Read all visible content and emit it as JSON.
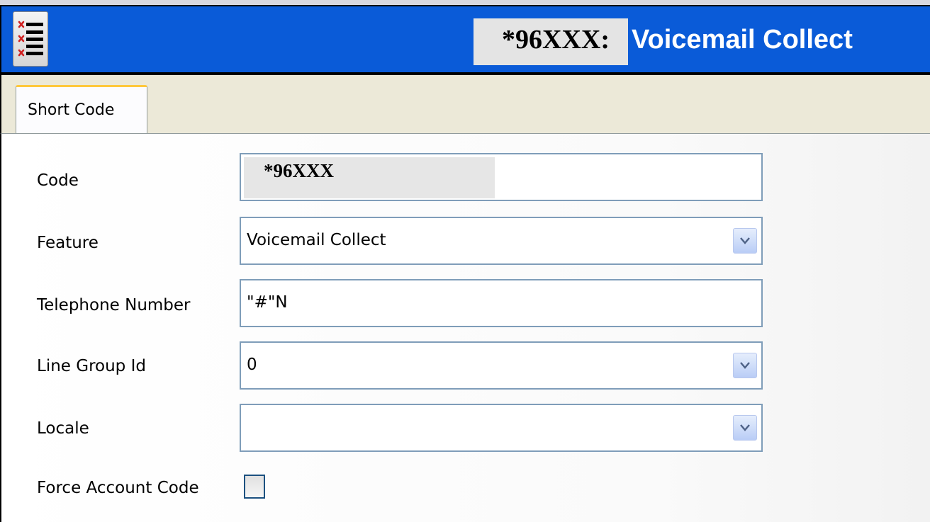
{
  "titlebar": {
    "code": "*96XXX:",
    "feature": "Voicemail Collect",
    "app_icon": "list-icon"
  },
  "tabs": [
    {
      "label": "Short Code",
      "selected": true
    }
  ],
  "form": {
    "code": {
      "label": "Code",
      "value": "*96XXX"
    },
    "feature": {
      "label": "Feature",
      "value": "Voicemail Collect",
      "icon": "chevron-down-icon"
    },
    "telephone_number": {
      "label": "Telephone Number",
      "value": "\"#\"N"
    },
    "line_group_id": {
      "label": "Line Group Id",
      "value": "0",
      "icon": "chevron-down-icon"
    },
    "locale": {
      "label": "Locale",
      "value": "",
      "icon": "chevron-down-icon"
    },
    "force_account_code": {
      "label": "Force Account Code",
      "checked": false
    }
  },
  "colors": {
    "titlebar": "#0a5bd8",
    "tab_highlight": "#ffc83c",
    "field_border": "#7f9db9"
  }
}
